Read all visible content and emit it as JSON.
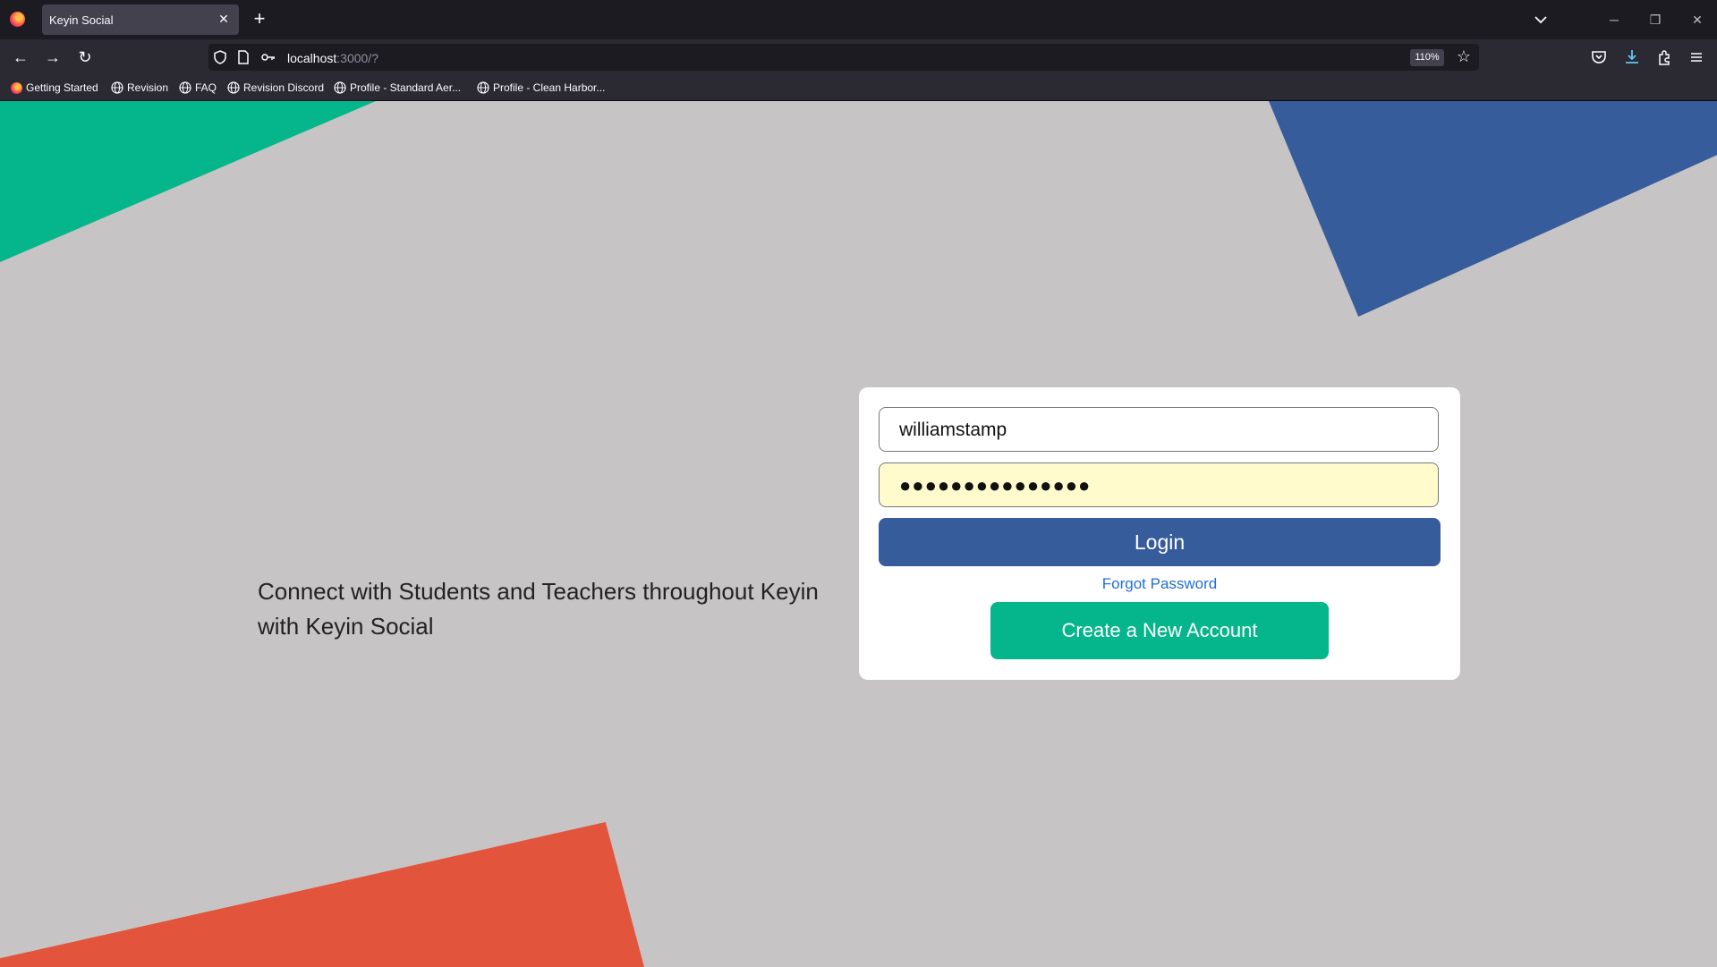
{
  "browser": {
    "tab": {
      "title": "Keyin Social"
    },
    "url": {
      "host": "localhost",
      "rest": ":3000/?"
    },
    "zoom": "110%",
    "bookmarks": [
      {
        "label": "Getting Started"
      },
      {
        "label": "Revision"
      },
      {
        "label": "FAQ"
      },
      {
        "label": "Revision Discord"
      },
      {
        "label": "Profile - Standard Aer..."
      },
      {
        "label": "Profile - Clean Harbor..."
      }
    ]
  },
  "page": {
    "tagline": "Connect with Students and Teachers throughout Keyin with Keyin Social",
    "login": {
      "username_value": "williamstamp",
      "password_masked": "●●●●●●●●●●●●●●●",
      "login_label": "Login",
      "forgot_label": "Forgot Password",
      "create_label": "Create a New Account"
    },
    "colors": {
      "background": "#c6c4c5",
      "green": "#05b58b",
      "blue": "#375c9c",
      "red": "#e2543c"
    }
  }
}
